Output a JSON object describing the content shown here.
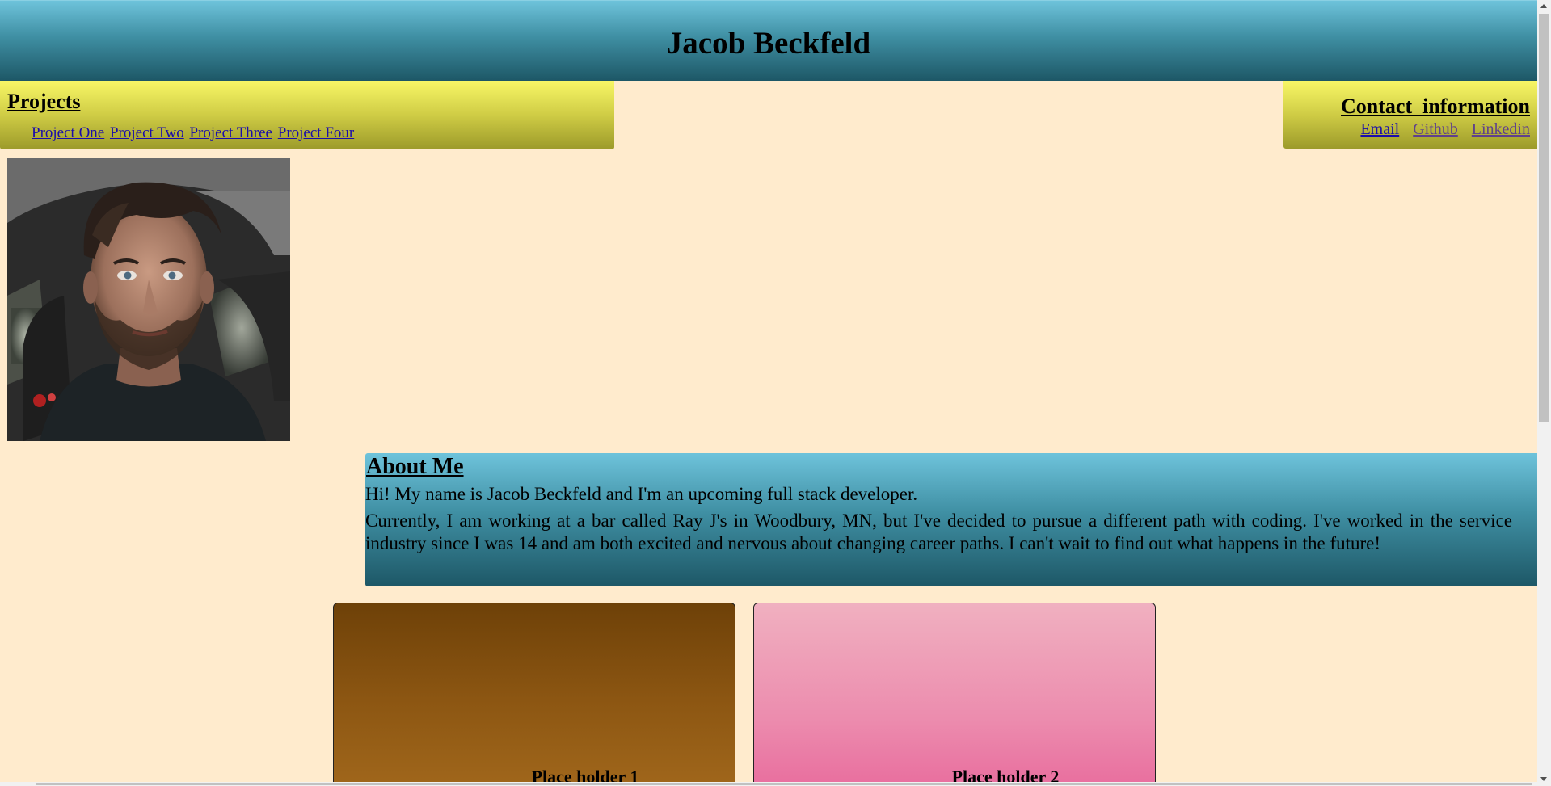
{
  "header": {
    "title": "Jacob Beckfeld"
  },
  "projects": {
    "heading": "Projects",
    "links": [
      "Project One",
      "Project Two",
      "Project Three",
      "Project Four"
    ]
  },
  "contact": {
    "heading": "Contact  information",
    "links": [
      "Email",
      "Github",
      "Linkedin"
    ]
  },
  "profile": {
    "photo_description": "profile-photo"
  },
  "about": {
    "heading": "About Me",
    "paragraphs": [
      " Hi! My name is Jacob Beckfeld and I'm an upcoming full stack developer.",
      " Currently, I am working at a bar called Ray J's in Woodbury, MN, but I've decided to pursue a different path with coding. I've worked in the service industry since I was 14 and am both excited and nervous about changing career paths. I can't wait to find out what happens in the future!"
    ]
  },
  "cards": [
    {
      "label": "Place holder 1",
      "color_top": "#6e4108",
      "color_bottom": "#a2681c"
    },
    {
      "label": "Place holder 2",
      "color_top": "#f0b0c0",
      "color_bottom": "#e86a9c"
    }
  ],
  "colors": {
    "page_background": "#ffebcd",
    "header_teal": "#3f8fa3",
    "nav_yellow": "#cfcc45",
    "link_blue": "#1a0dab",
    "link_visited": "#60418b"
  }
}
